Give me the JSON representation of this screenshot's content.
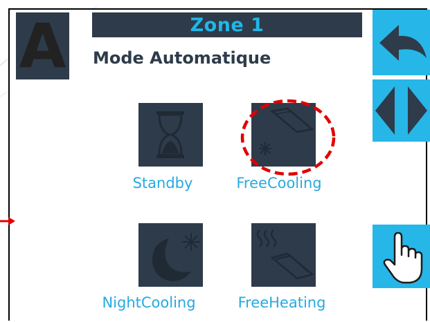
{
  "header": {
    "mode_letter": "A",
    "zone_title": "Zone 1",
    "mode_title": "Mode Automatique"
  },
  "side_buttons": [
    {
      "name": "back",
      "icon": "back-arrow-icon"
    },
    {
      "name": "toggle",
      "icon": "left-right-arrows-icon"
    },
    {
      "name": "manual",
      "icon": "hand-pointer-icon"
    }
  ],
  "modes": [
    {
      "id": "standby",
      "label": "Standby",
      "icon": "hourglass-icon"
    },
    {
      "id": "freecooling",
      "label": "FreeCooling",
      "icon": "freecooling-icon",
      "highlighted": true
    },
    {
      "id": "nightcooling",
      "label": "NightCooling",
      "icon": "moon-snowflake-icon"
    },
    {
      "id": "freeheating",
      "label": "FreeHeating",
      "icon": "heat-waves-icon"
    }
  ],
  "colors": {
    "accent": "#26b6e8",
    "tile": "#2e3b4a",
    "label": "#26a9e0",
    "highlight": "#e00000"
  }
}
